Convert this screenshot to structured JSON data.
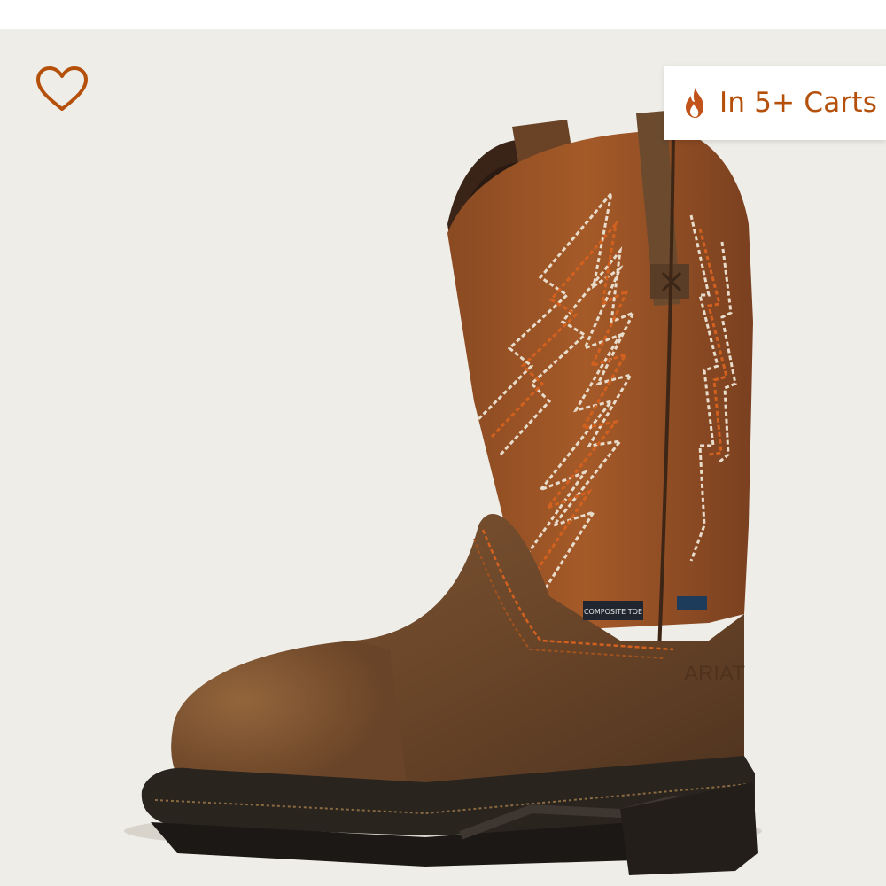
{
  "product_card": {
    "favorite_icon": "heart-outline-icon",
    "badge": {
      "icon": "flame-icon",
      "text": "In 5+ Carts",
      "color": "#b5500b"
    },
    "image": {
      "description_icon": "boot-image",
      "label_tag": "COMPOSITE TOE",
      "brand_mark": "ARIAT"
    },
    "colors": {
      "background": "#efede8",
      "accent": "#b5500b"
    }
  }
}
